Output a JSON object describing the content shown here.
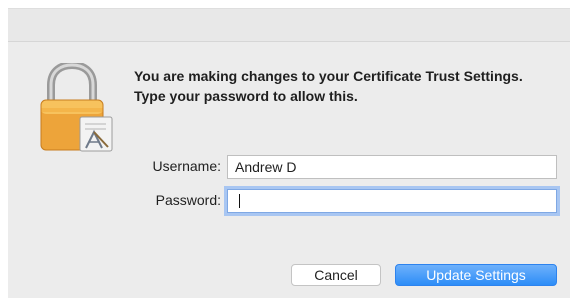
{
  "dialog": {
    "message": "You are making changes to your Certificate Trust Settings. Type your password to allow this.",
    "icon": "lock-with-certificate-icon"
  },
  "form": {
    "username_label": "Username:",
    "username_value": "Andrew D",
    "password_label": "Password:",
    "password_value": ""
  },
  "buttons": {
    "cancel_label": "Cancel",
    "update_label": "Update Settings"
  },
  "colors": {
    "accent": "#2d8df7",
    "window_background": "#ececec",
    "focus_ring": "#a8c6f2",
    "lock_gold": "#f1a93a"
  }
}
